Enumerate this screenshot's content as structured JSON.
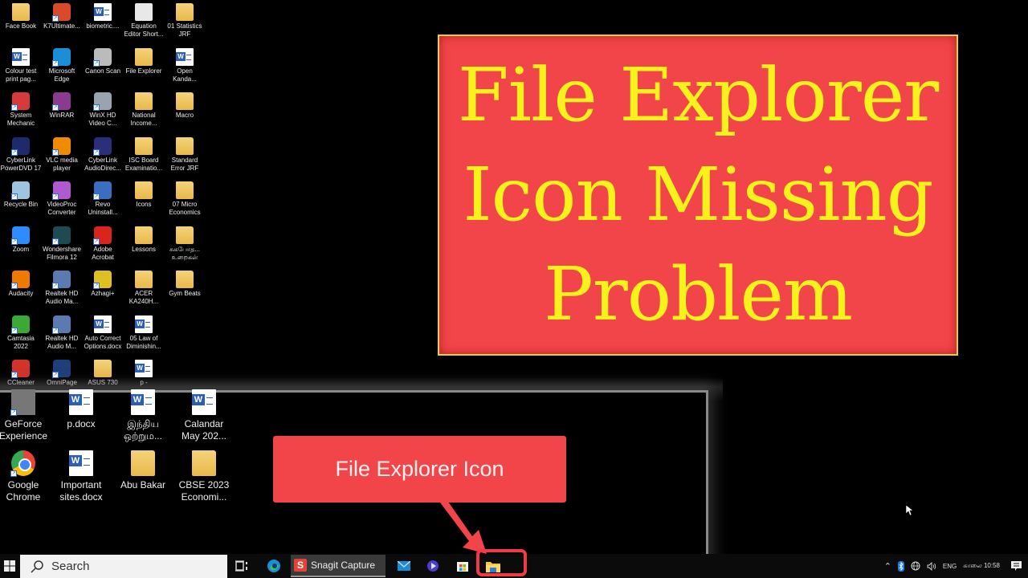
{
  "desktop": {
    "icons": [
      {
        "label": "Face Book",
        "type": "folder"
      },
      {
        "label": "K7Ultimate...",
        "type": "app",
        "color": "#d94a2a"
      },
      {
        "label": "biometric....",
        "type": "word"
      },
      {
        "label": "Equation\nEditor Short...",
        "type": "doc"
      },
      {
        "label": "01 Statistics\nJRF",
        "type": "folder"
      },
      {
        "label": "Colour test\nprint pag...",
        "type": "word"
      },
      {
        "label": "Microsoft\nEdge",
        "type": "app",
        "color": "#1b8fd6"
      },
      {
        "label": "Canon Scan",
        "type": "app",
        "color": "#bbbbbb"
      },
      {
        "label": "File Explorer",
        "type": "folder"
      },
      {
        "label": "Open\nKanda...",
        "type": "word"
      },
      {
        "label": "System\nMechanic",
        "type": "app",
        "color": "#d63a3a"
      },
      {
        "label": "WinRAR",
        "type": "app",
        "color": "#8a3b8f"
      },
      {
        "label": "WinX HD\nVideo C...",
        "type": "app",
        "color": "#9aa4b0"
      },
      {
        "label": "National\nIncome...",
        "type": "folder"
      },
      {
        "label": "Macro",
        "type": "folder"
      },
      {
        "label": "CyberLink\nPowerDVD 17",
        "type": "app",
        "color": "#1d2a6b"
      },
      {
        "label": "VLC media\nplayer",
        "type": "app",
        "color": "#f08a00"
      },
      {
        "label": "CyberLink\nAudioDirec...",
        "type": "app",
        "color": "#2a2f7a"
      },
      {
        "label": "ISC Board\nExaminatio...",
        "type": "folder"
      },
      {
        "label": "Standard\nError JRF",
        "type": "folder"
      },
      {
        "label": "Recycle Bin",
        "type": "app",
        "color": "#9fc4e0"
      },
      {
        "label": "VideoProc\nConverter",
        "type": "app",
        "color": "#b05ad0"
      },
      {
        "label": "Revo\nUninstall...",
        "type": "app",
        "color": "#3a6fc0"
      },
      {
        "label": "Icons",
        "type": "folder"
      },
      {
        "label": "07  Micro\nEconomics",
        "type": "folder"
      },
      {
        "label": "Zoom",
        "type": "app",
        "color": "#2d8cff"
      },
      {
        "label": "Wondershare\nFilmora 12",
        "type": "app",
        "color": "#1e4a52"
      },
      {
        "label": "Adobe\nAcrobat",
        "type": "app",
        "color": "#d9251c"
      },
      {
        "label": "Lessons",
        "type": "folder"
      },
      {
        "label": "சுகபோத...\nஉறைகள்",
        "type": "folder"
      },
      {
        "label": "Audacity",
        "type": "app",
        "color": "#f07a00"
      },
      {
        "label": "Realtek HD\nAudio Ma...",
        "type": "app",
        "color": "#5a7ab0"
      },
      {
        "label": "Azhagi+",
        "type": "app",
        "color": "#e0c020"
      },
      {
        "label": "ACER\nKA240H...",
        "type": "folder"
      },
      {
        "label": "Gym Beats",
        "type": "folder"
      },
      {
        "label": "Camtasia\n2022",
        "type": "app",
        "color": "#3ba935"
      },
      {
        "label": "Realtek HD\nAudio M...",
        "type": "app",
        "color": "#5a7ab0"
      },
      {
        "label": "Auto Correct\nOptions.docx",
        "type": "word"
      },
      {
        "label": "05  Law of\nDiminishin...",
        "type": "word"
      },
      {
        "label": "",
        "type": "none"
      },
      {
        "label": "CCleaner",
        "type": "app",
        "color": "#d2332b"
      },
      {
        "label": "OmniPage",
        "type": "app",
        "color": "#1e3f7a"
      },
      {
        "label": "ASUS 730",
        "type": "folder"
      },
      {
        "label": "p -",
        "type": "word"
      }
    ]
  },
  "title_card": {
    "lines": [
      "File Explorer",
      "Icon Missing",
      "Problem"
    ],
    "bg_color": "#f24549",
    "text_color": "#f7f21c"
  },
  "inset": {
    "icons": [
      {
        "label": "GeForce\nExperience",
        "type": "geforce"
      },
      {
        "label": "p.docx",
        "type": "word"
      },
      {
        "label": "இந்திய\nஒற்றும...",
        "type": "word"
      },
      {
        "label": "Calandar\nMay 202...",
        "type": "word"
      },
      {
        "label": "Google\nChrome",
        "type": "chrome"
      },
      {
        "label": "Important\nsites.docx",
        "type": "word"
      },
      {
        "label": "Abu Bakar",
        "type": "folder"
      },
      {
        "label": "CBSE  2023\nEconomi...",
        "type": "folder"
      }
    ],
    "callout_text": "File Explorer Icon",
    "callout_color": "#f24549"
  },
  "taskbar": {
    "search_placeholder": "Search",
    "snagit_label": "Snagit Capture",
    "tray": {
      "language": "ENG",
      "time": "காலை 10:58"
    }
  }
}
